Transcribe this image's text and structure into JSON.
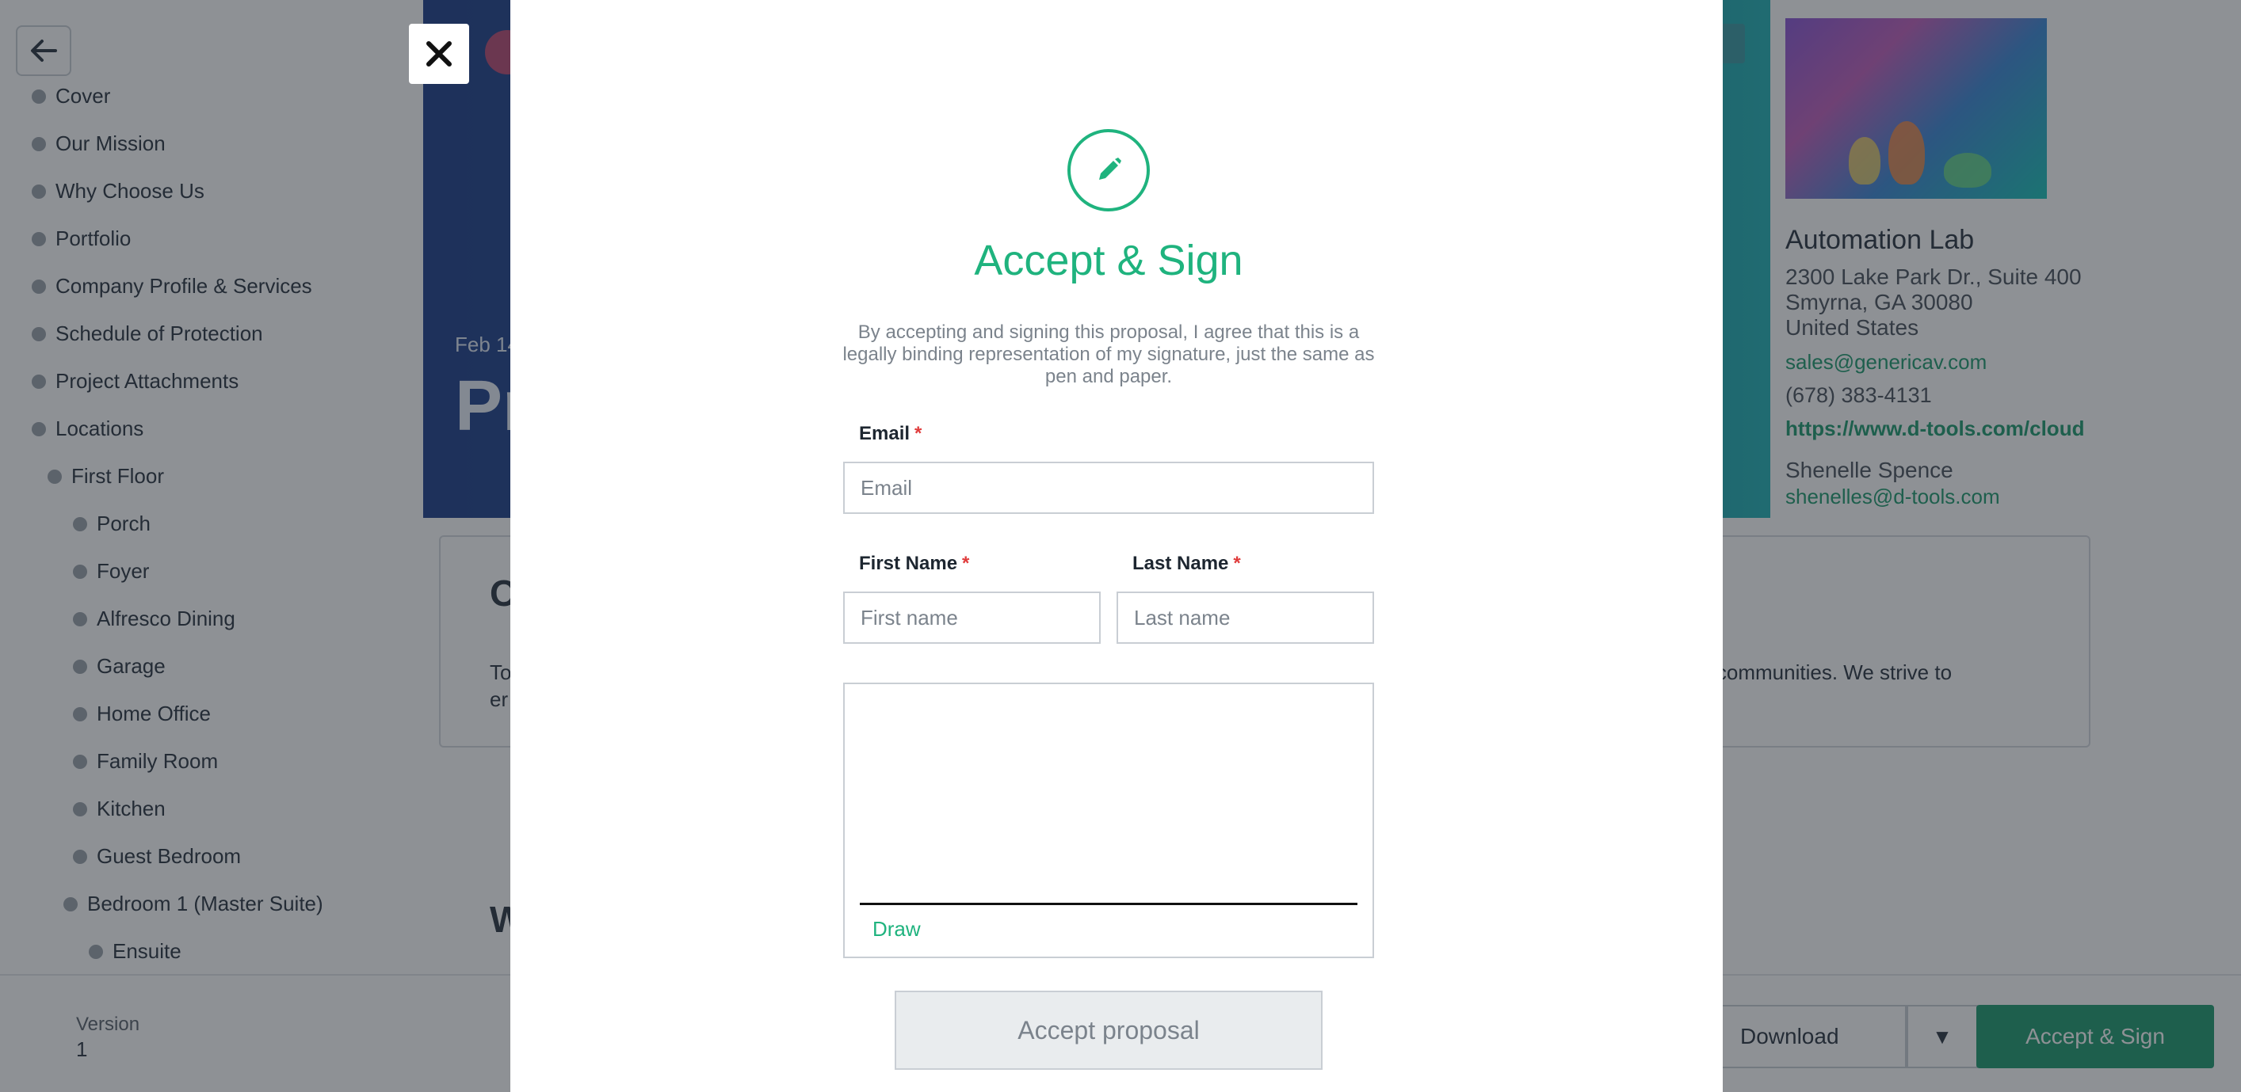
{
  "sidebar": {
    "items": [
      {
        "label": "Cover"
      },
      {
        "label": "Our Mission"
      },
      {
        "label": "Why Choose Us"
      },
      {
        "label": "Portfolio"
      },
      {
        "label": "Company Profile & Services"
      },
      {
        "label": "Schedule of Protection"
      },
      {
        "label": "Project Attachments"
      },
      {
        "label": "Locations"
      },
      {
        "label": "First Floor"
      },
      {
        "label": "Porch"
      },
      {
        "label": "Foyer"
      },
      {
        "label": "Alfresco Dining"
      },
      {
        "label": "Garage"
      },
      {
        "label": "Home Office"
      },
      {
        "label": "Family Room"
      },
      {
        "label": "Kitchen"
      },
      {
        "label": "Guest Bedroom"
      },
      {
        "label": "Bedroom 1 (Master Suite)"
      },
      {
        "label": "Ensuite"
      }
    ]
  },
  "hero": {
    "date": "Feb 14",
    "title": "Pr"
  },
  "company": {
    "name": "Automation Lab",
    "address_line1": "2300 Lake Park Dr., Suite 400",
    "address_line2": "Smyrna, GA 30080",
    "address_line3": "United States",
    "email": "sales@genericav.com",
    "phone": "(678) 383-4131",
    "website": "https://www.d-tools.com/cloud",
    "contact_name": "Shenelle Spence",
    "contact_email": "shenelles@d-tools.com"
  },
  "content": {
    "heading_fragment": "O",
    "text_left_fragment": "To",
    "text_right_fragment": "r communities. We strive to",
    "text_line2_fragment": "er",
    "heading2_fragment": "W"
  },
  "footer": {
    "version_label": "Version",
    "version_value": "1",
    "download_label": "Download",
    "dropdown_glyph": "▼",
    "accept_sign_label": "Accept & Sign"
  },
  "modal": {
    "close_glyph": "✕",
    "title": "Accept & Sign",
    "description": "By accepting and signing this proposal, I agree that this is a legally binding representation of my signature, just the same as pen and paper.",
    "email_label": "Email",
    "email_placeholder": "Email",
    "first_name_label": "First Name",
    "first_name_placeholder": "First name",
    "last_name_label": "Last Name",
    "last_name_placeholder": "Last name",
    "required_marker": "*",
    "draw_label": "Draw",
    "accept_button": "Accept proposal"
  },
  "colors": {
    "accent_green": "#1fb37e",
    "button_green": "#1f9a6e",
    "required_red": "#e03b3b"
  }
}
